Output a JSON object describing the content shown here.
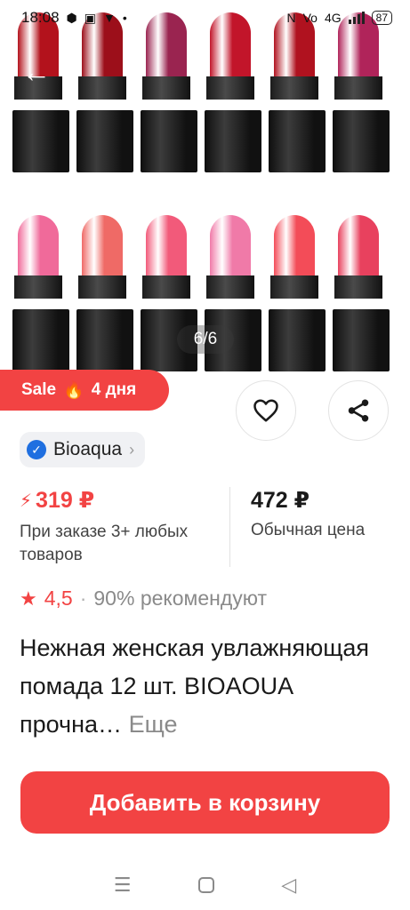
{
  "status_bar": {
    "time": "18:08",
    "network": "4G",
    "battery": "87"
  },
  "icons": {
    "back": "arrow-left",
    "heart": "heart-outline",
    "share": "share",
    "verified": "check-badge",
    "fire": "🔥",
    "star": "★",
    "bolt": "⚡"
  },
  "gallery": {
    "counter": "6/6",
    "top_row_colors": [
      "#b3121c",
      "#9c0f1a",
      "#9a2450",
      "#c2152a",
      "#b0121f",
      "#b0245a"
    ],
    "bottom_row_colors": [
      "#f06a9a",
      "#ef6a66",
      "#f25a7a",
      "#f07aa8",
      "#f34c58",
      "#e8415e"
    ]
  },
  "sale_badge": {
    "label": "Sale",
    "days": "4 дня"
  },
  "brand": {
    "name": "Bioaqua"
  },
  "price": {
    "sale_value": "319 ₽",
    "sale_note": "При заказе 3+ любых товаров",
    "regular_value": "472 ₽",
    "regular_note": "Обычная цена"
  },
  "rating": {
    "value": "4,5",
    "separator": "·",
    "recommend": "90% рекомендуют"
  },
  "product": {
    "title": "Нежная женская увлажняющая помада 12 шт. BIOAOUA прочна…",
    "more": "Еще"
  },
  "cart_button": {
    "label": "Добавить в корзину"
  },
  "colors": {
    "accent": "#f24343",
    "verified": "#1f6fe0"
  }
}
